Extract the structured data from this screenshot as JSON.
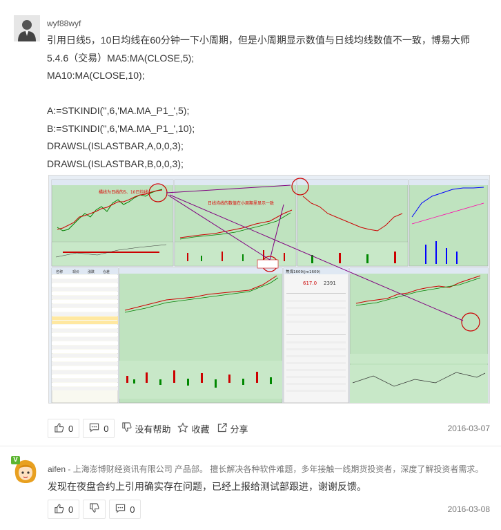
{
  "post1": {
    "username": "wyf88wyf",
    "lines": [
      "引用日线5，10日均线在60分钟一下小周期，但是小周期显示数值与日线均线数值不一致，博易大师",
      "5.4.6（交易）MA5:MA(CLOSE,5);",
      "MA10:MA(CLOSE,10);",
      "",
      "A:=STKINDI('',6,'MA.MA_P1_',5);",
      "B:=STKINDI('',6,'MA.MA_P1_',10);",
      "DRAWSL(ISLASTBAR,A,0,0,3);",
      "DRAWSL(ISLASTBAR,B,0,0,3);"
    ],
    "screenshot": {
      "note_left": "橘线为日线的5、10日均线",
      "note_middle": "日线均线的数值在小周期里显示一致",
      "table_header": [
        "名称",
        "现价",
        "涨跌",
        "仓差"
      ],
      "quote_title": "焦煤1609(jm1609)",
      "quote_price": "617.0",
      "quote_vol": "2391"
    },
    "actions": {
      "like_count": "0",
      "comment_count": "0",
      "unhelpful_label": "没有帮助",
      "favorite_label": "收藏",
      "share_label": "分享"
    },
    "date": "2016-03-07"
  },
  "post2": {
    "badge": "V",
    "username": "aifen",
    "description": " - 上海澎博财经资讯有限公司 产品部。 擅长解决各种软件难题，多年接触一线期货投资者，深度了解投资者需求。",
    "reply": "发现在夜盘合约上引用确实存在问题，已经上报给测试部跟进，谢谢反馈。",
    "actions": {
      "like_count": "0",
      "comment_count": "0"
    },
    "date": "2016-03-08"
  },
  "colors": {
    "chart_bg": "#b8e0b8",
    "up": "#ff0000",
    "down": "#008000",
    "annotation": "#800080",
    "badge": "#5cb531"
  }
}
